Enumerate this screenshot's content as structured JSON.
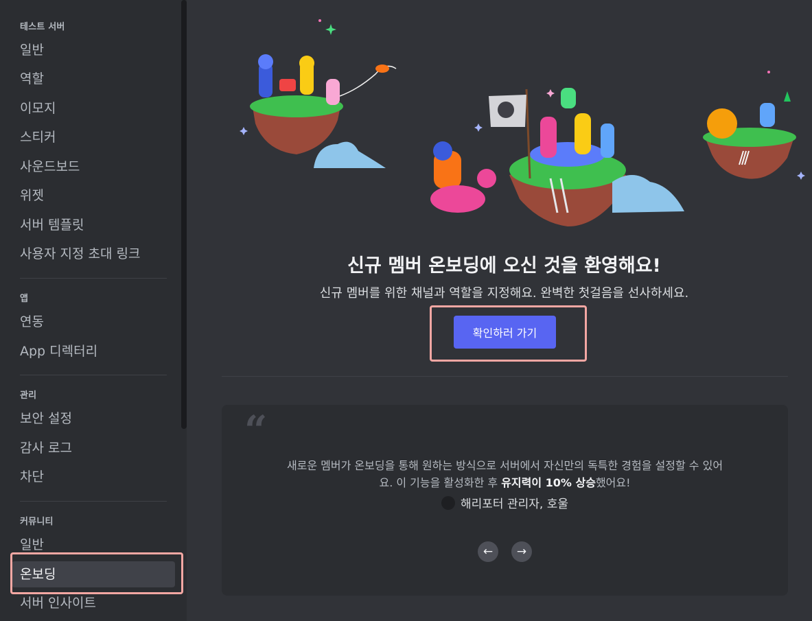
{
  "sidebar": {
    "sections": [
      {
        "header": "테스트 서버",
        "items": [
          "일반",
          "역할",
          "이모지",
          "스티커",
          "사운드보드",
          "위젯",
          "서버 템플릿",
          "사용자 지정 초대 링크"
        ]
      },
      {
        "header": "앱",
        "items": [
          "연동",
          "App 디렉터리"
        ]
      },
      {
        "header": "관리",
        "items": [
          "보안 설정",
          "감사 로그",
          "차단"
        ]
      },
      {
        "header": "커뮤니티",
        "items": [
          "일반",
          "온보딩",
          "서버 인사이트"
        ]
      }
    ],
    "active_item": "온보딩"
  },
  "main": {
    "title": "신규 멤버 온보딩에 오신 것을 환영해요!",
    "subtitle": "신규 멤버를 위한 채널과 역할을 지정해요. 완벽한 첫걸음을 선사하세요.",
    "cta_label": "확인하러 가기",
    "quote": {
      "mark": "“",
      "text_before": "새로운 멤버가 온보딩을 통해 원하는 방식으로 서버에서 자신만의 독특한 경험을 설정할 수 있어요. 이 기능을 활성화한 후 ",
      "text_bold": "유지력이 10% 상승",
      "text_after": "했어요!",
      "author": "해리포터 관리자, 호울"
    },
    "prev_icon": "arrow-left-icon",
    "next_icon": "arrow-right-icon"
  },
  "colors": {
    "accent": "#5865f2",
    "highlight": "#f4a7a3",
    "background": "#313338",
    "sidebar": "#2b2d31"
  }
}
